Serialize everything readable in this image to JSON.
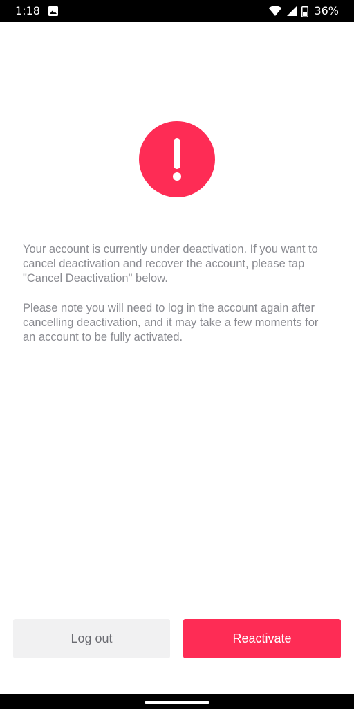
{
  "status_bar": {
    "time": "1:18",
    "battery_percent": "36%",
    "icons": [
      "image-notification-icon",
      "wifi-icon",
      "cellular-signal-icon",
      "battery-icon"
    ]
  },
  "alert": {
    "icon": "exclamation-circle-icon",
    "color": "#fe2c55"
  },
  "message": {
    "paragraph_1": "Your account is currently under deactivation. If you want to cancel deactivation and recover the account, please tap \"Cancel Deactivation\" below.",
    "paragraph_2": "Please note you will need to log in the account again after cancelling deactivation, and it may take a few moments for an account to be fully activated."
  },
  "actions": {
    "logout_label": "Log out",
    "reactivate_label": "Reactivate"
  },
  "colors": {
    "accent": "#fe2c55",
    "secondary_button": "#f1f1f2",
    "body_text": "#8a8b91"
  }
}
